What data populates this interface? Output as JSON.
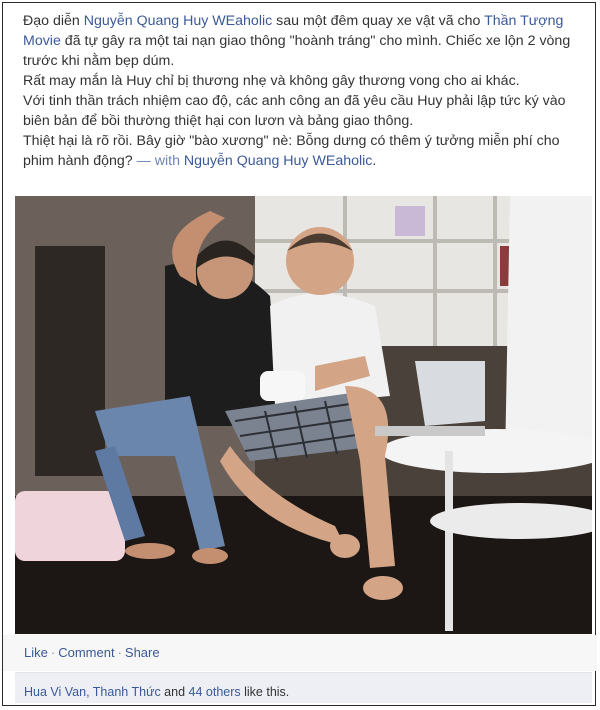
{
  "post": {
    "p1_a": "Đạo diễn ",
    "p1_author": "Nguyễn Quang Huy WEaholic",
    "p1_b": " sau một đêm quay xe vật vã cho ",
    "p1_page": "Thần Tượng Movie",
    "p1_c": " đã tự gây ra một tai nạn giao thông \"hoành tráng\" cho mình. Chiếc xe lộn 2 vòng trước khi nằm bẹp dúm.",
    "p2": "Rất may mắn là Huy chỉ bị thương nhẹ và không gây thương vong cho ai khác.",
    "p3": "Với tinh thần trách nhiệm cao độ, các anh công an đã yêu cầu Huy phải lập tức ký vào biên bản để bồi thường thiệt hại con lươn và bảng giao thông.",
    "p4_a": "Thiệt hại là rõ rồi. Bây giờ \"bào xương\" nè: Bỗng dưng có thêm ý tưởng miễn phí cho phim hành động? ",
    "p4_with": "— with",
    "p4_tag": "Nguyễn Quang Huy WEaholic",
    "p4_end": "."
  },
  "actions": {
    "like": "Like",
    "comment": "Comment",
    "share": "Share",
    "separator": "·"
  },
  "likes": {
    "names": "Hua Vi Van, Thanh Thức",
    "and": " and ",
    "others": "44 others",
    "suffix": " like this."
  },
  "colors": {
    "link": "#3b5998",
    "text": "#333333",
    "likes_bg": "#edeff4",
    "actions_bg": "#f7f7f7"
  }
}
